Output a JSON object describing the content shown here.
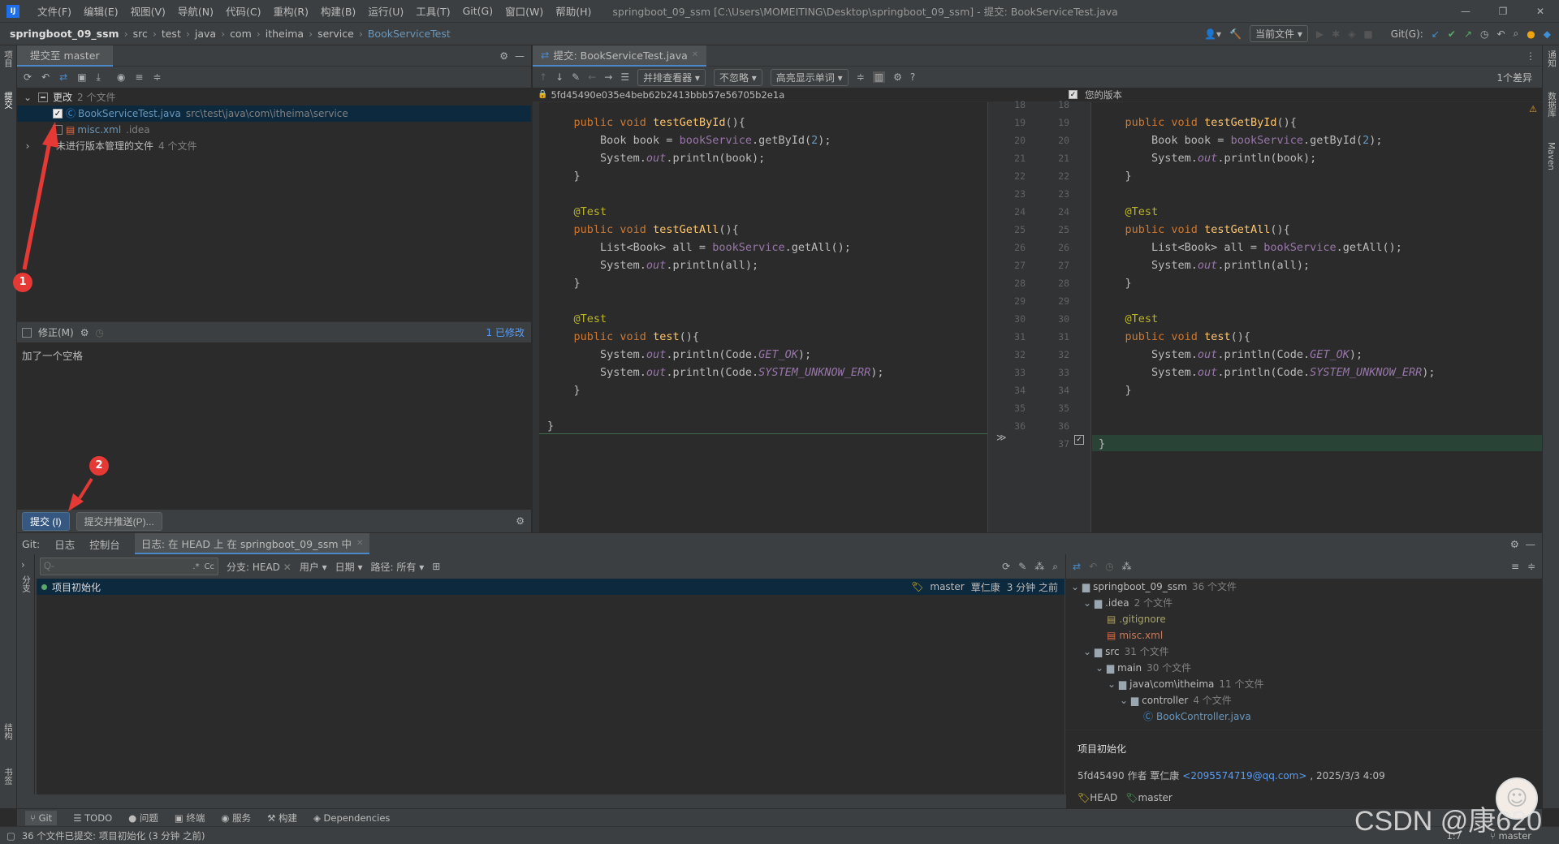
{
  "titlebar": {
    "menu": [
      "文件(F)",
      "编辑(E)",
      "视图(V)",
      "导航(N)",
      "代码(C)",
      "重构(R)",
      "构建(B)",
      "运行(U)",
      "工具(T)",
      "Git(G)",
      "窗口(W)",
      "帮助(H)"
    ],
    "title": "springboot_09_ssm [C:\\Users\\MOMEITING\\Desktop\\springboot_09_ssm] - 提交: BookServiceTest.java"
  },
  "navbar": {
    "crumbs": [
      "springboot_09_ssm",
      "src",
      "test",
      "java",
      "com",
      "itheima",
      "service",
      "BookServiceTest"
    ],
    "run_config": "当前文件",
    "git_label": "Git(G):"
  },
  "commit_panel": {
    "tab": "提交至 master",
    "changes_label": "更改",
    "changes_count": "2 个文件",
    "files": [
      {
        "name": "BookServiceTest.java",
        "path": "src\\test\\java\\com\\itheima\\service",
        "checked": true
      },
      {
        "name": "misc.xml",
        "path": ".idea",
        "checked": false
      }
    ],
    "unversioned_label": "未进行版本管理的文件",
    "unversioned_count": "4 个文件",
    "amend_label": "修正(M)",
    "modified_count": "1 已修改",
    "message": "加了一个空格",
    "commit_btn": "提交 (I)",
    "commit_push_btn": "提交并推送(P)..."
  },
  "annotations": {
    "a1": "1",
    "a2": "2"
  },
  "diff": {
    "tab": "提交: BookServiceTest.java",
    "viewer": "并排查看器",
    "ignore": "不忽略",
    "highlight": "高亮显示单词",
    "diff_count": "1个差异",
    "hash": "5fd45490e035e4beb62b2413bbb57e56705b2e1a",
    "your_version": "您的版本",
    "lines_left": [
      "18",
      "19",
      "20",
      "21",
      "22",
      "23",
      "24",
      "25",
      "26",
      "27",
      "28",
      "29",
      "30",
      "31",
      "32",
      "33",
      "34",
      "35",
      "36"
    ],
    "lines_right": [
      "18",
      "19",
      "20",
      "21",
      "22",
      "23",
      "24",
      "25",
      "26",
      "27",
      "28",
      "29",
      "30",
      "31",
      "32",
      "33",
      "34",
      "35",
      "36",
      "37"
    ]
  },
  "bottom": {
    "tabs": [
      "Git:",
      "日志",
      "控制台",
      "日志: 在 HEAD 上 在 springboot_09_ssm 中"
    ],
    "filters": {
      "branch": "分支: HEAD",
      "user": "用户",
      "date": "日期",
      "path": "路径: 所有"
    },
    "search_placeholder": "Q-",
    "commit_row": {
      "msg": "项目初始化",
      "branch": "master",
      "author": "覃仁康",
      "time": "3 分钟 之前"
    },
    "tree": [
      {
        "label": "springboot_09_ssm",
        "count": "36 个文件",
        "level": 0,
        "type": "folder"
      },
      {
        "label": ".idea",
        "count": "2 个文件",
        "level": 1,
        "type": "folder"
      },
      {
        "label": ".gitignore",
        "count": "",
        "level": 2,
        "type": "file-y"
      },
      {
        "label": "misc.xml",
        "count": "",
        "level": 2,
        "type": "file-r"
      },
      {
        "label": "src",
        "count": "31 个文件",
        "level": 1,
        "type": "folder"
      },
      {
        "label": "main",
        "count": "30 个文件",
        "level": 2,
        "type": "folder"
      },
      {
        "label": "java\\com\\itheima",
        "count": "11 个文件",
        "level": 3,
        "type": "folder"
      },
      {
        "label": "controller",
        "count": "4 个文件",
        "level": 4,
        "type": "folder"
      },
      {
        "label": "BookController.java",
        "count": "",
        "level": 5,
        "type": "file-j"
      }
    ],
    "detail_title": "项目初始化",
    "detail_hash": "5fd45490 作者 覃仁康",
    "detail_email": "<2095574719@qq.com>",
    "detail_date": ", 2025/3/3 4:09",
    "detail_tags": [
      "HEAD",
      "master"
    ]
  },
  "toolstrip": [
    "Git",
    "TODO",
    "问题",
    "终端",
    "服务",
    "构建",
    "Dependencies"
  ],
  "statusbar": {
    "msg": "36 个文件已提交: 项目初始化 (3 分钟 之前)",
    "pos": "1:7",
    "branch": "master"
  },
  "left_strip": [
    "项目",
    "提交",
    "结构",
    "书签"
  ],
  "right_strip": [
    "通知",
    "数据库",
    "Maven"
  ],
  "watermark": "CSDN @康620",
  "colors": {
    "accent": "#365880",
    "selection": "#0d293e",
    "added": "#294436",
    "annotation": "#e53935"
  }
}
